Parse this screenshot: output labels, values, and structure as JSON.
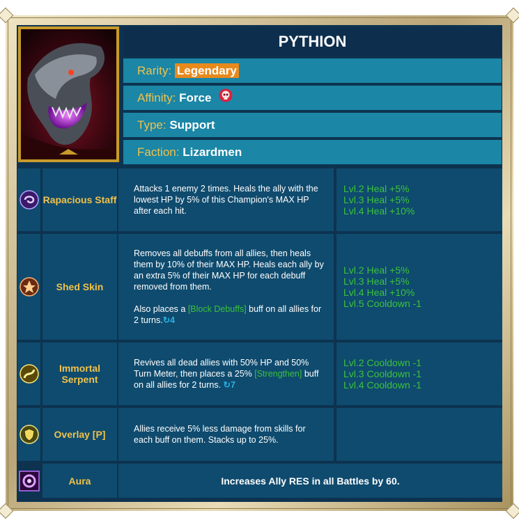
{
  "champion": {
    "name": "PYTHION",
    "rarity_label": "Rarity:",
    "rarity_value": "Legendary",
    "affinity_label": "Affinity:",
    "affinity_value": "Force",
    "type_label": "Type:",
    "type_value": "Support",
    "faction_label": "Faction:",
    "faction_value": "Lizardmen"
  },
  "skills": [
    {
      "name": "Rapacious Staff",
      "icon": "swirl-skill-icon",
      "desc": "Attacks 1 enemy 2 times. Heals the ally with the lowest HP by 5% of this Champion's MAX HP after each hit.",
      "books": [
        "Lvl.2 Heal +5%",
        "Lvl.3 Heal +5%",
        "Lvl.4 Heal +10%"
      ]
    },
    {
      "name": "Shed Skin",
      "icon": "shed-skin-icon",
      "desc1": "Removes all debuffs from all allies, then heals them by 10% of their MAX HP. Heals each ally by an extra 5% of their MAX HP for each debuff removed from them.",
      "desc2_pre": "Also places a ",
      "desc2_buff": "[Block Debuffs]",
      "desc2_post": " buff on all allies for 2 turns.",
      "cooldown": "4",
      "books": [
        "Lvl.2 Heal +5%",
        "Lvl.3 Heal +5%",
        "Lvl.4 Heal +10%",
        "Lvl.5 Cooldown -1"
      ]
    },
    {
      "name": "Immortal Serpent",
      "icon": "serpent-skill-icon",
      "desc_pre": "Revives all dead allies with 50% HP and 50% Turn Meter, then places a 25% ",
      "desc_buff": "[Strengthen]",
      "desc_post": " buff on all allies for 2 turns. ",
      "cooldown": "7",
      "books": [
        "Lvl.2 Cooldown -1",
        "Lvl.3 Cooldown -1",
        "Lvl.4 Cooldown -1"
      ]
    },
    {
      "name": "Overlay [P]",
      "icon": "shield-skill-icon",
      "desc": "Allies receive 5% less damage from skills for each buff on them. Stacks up to 25%."
    }
  ],
  "aura": {
    "name": "Aura",
    "icon": "aura-icon",
    "desc": "Increases Ally RES in all Battles by 60."
  },
  "colors": {
    "background": "#0d3350",
    "cell": "#0f4b6e",
    "info_row": "#1b86a6",
    "label_gold": "#f1c24a",
    "legendary": "#e8891c",
    "book_green": "#3cc23c",
    "buff_green": "#39c239",
    "cooldown_blue": "#2bb1e6"
  }
}
